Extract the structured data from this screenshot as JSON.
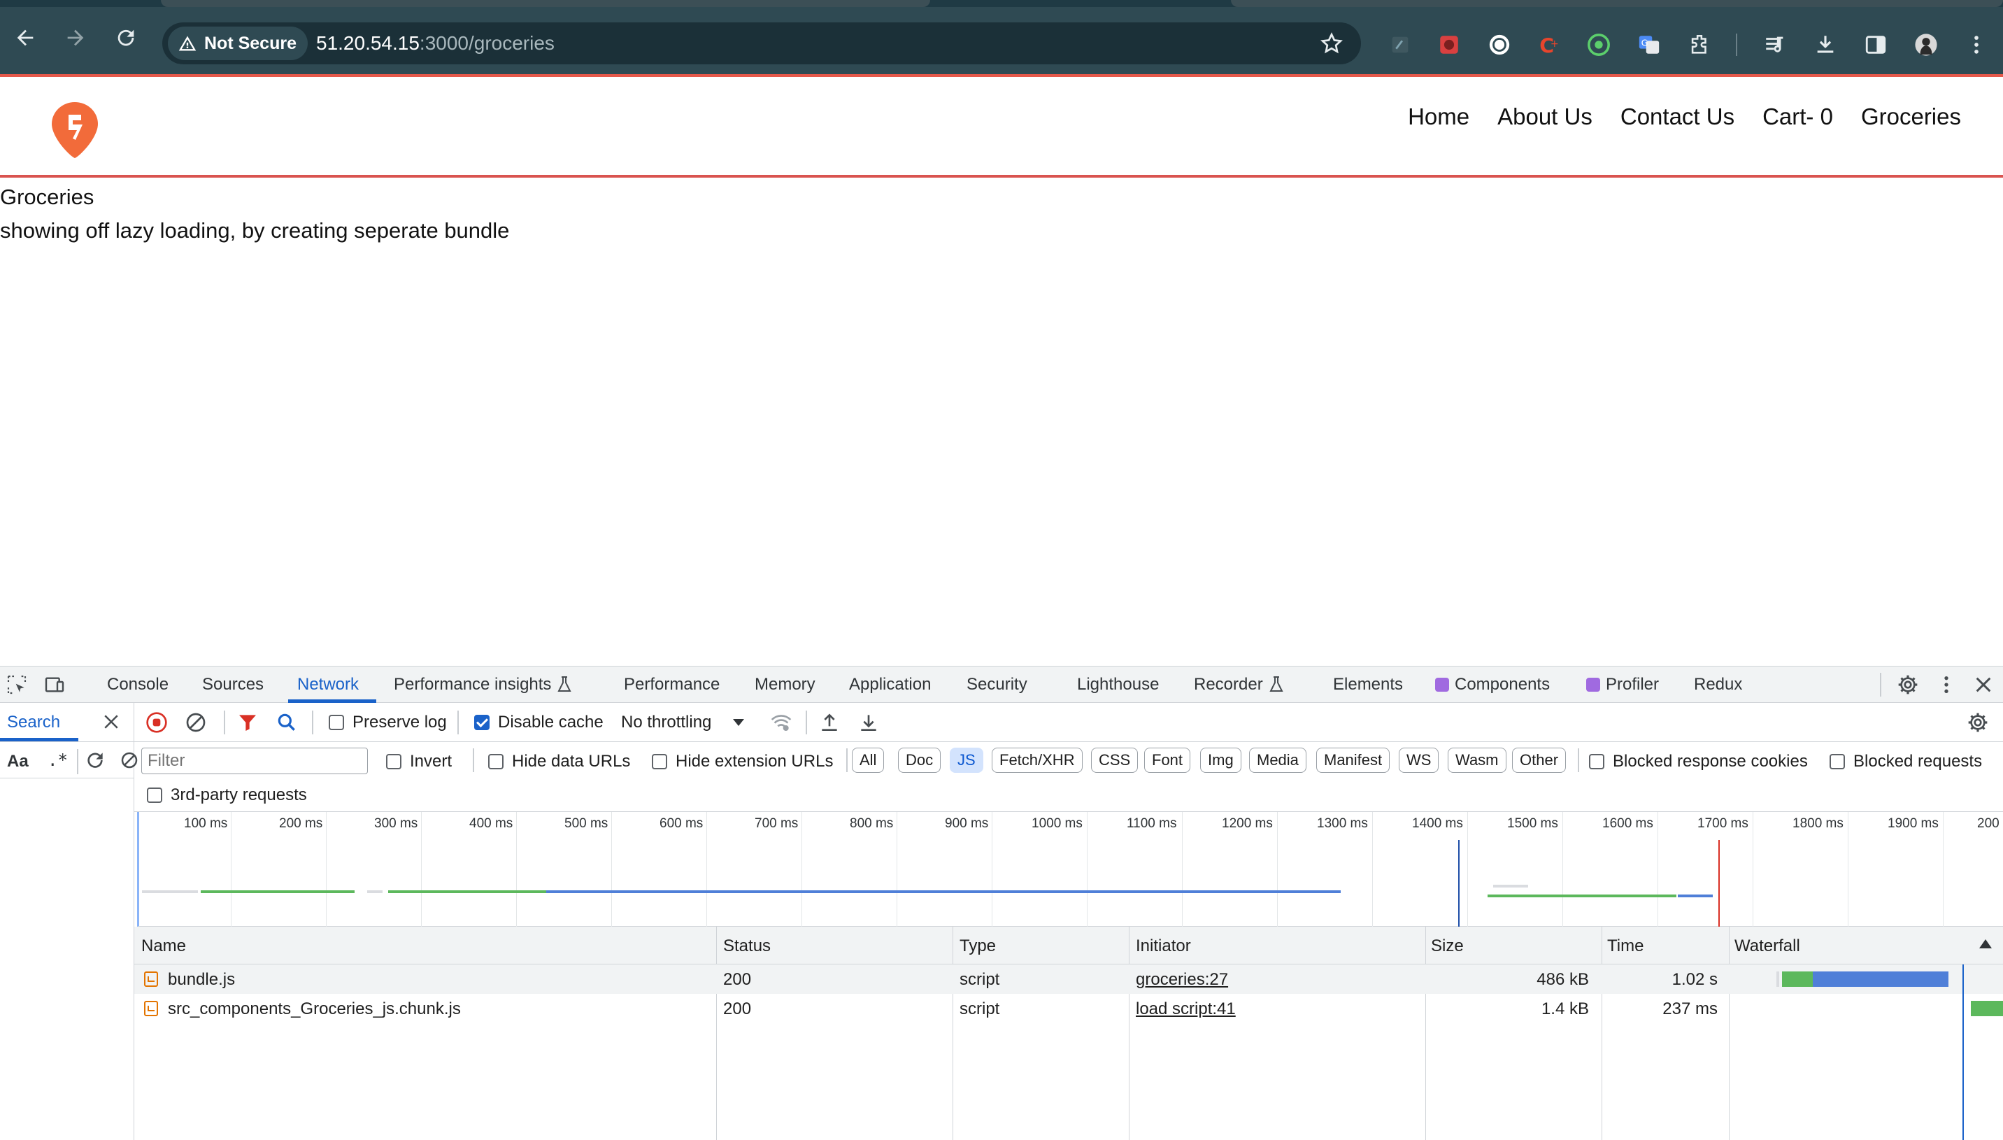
{
  "browser": {
    "security_label": "Not Secure",
    "url_host": "51.20.54.15",
    "url_rest": ":3000/groceries"
  },
  "page": {
    "nav": [
      "Home",
      "About Us",
      "Contact Us",
      "Cart- 0",
      "Groceries"
    ],
    "title": "Groceries",
    "subtitle": "showing off lazy loading, by creating seperate bundle",
    "accent_color": "#e5584a",
    "logo_color": "#f26b3a"
  },
  "devtools": {
    "tabs": [
      "Console",
      "Sources",
      "Network",
      "Performance insights",
      "Performance",
      "Memory",
      "Application",
      "Security",
      "Lighthouse",
      "Recorder",
      "Elements",
      "Components",
      "Profiler",
      "Redux"
    ],
    "active_tab": "Network",
    "search": {
      "tab_label": "Search",
      "case_label": "Aa",
      "regex_label": ".*"
    },
    "toolbar": {
      "preserve_log": "Preserve log",
      "disable_cache": "Disable cache",
      "throttling": "No throttling"
    },
    "filter": {
      "placeholder": "Filter",
      "invert": "Invert",
      "hide_data_urls": "Hide data URLs",
      "hide_extension_urls": "Hide extension URLs",
      "types": [
        "All",
        "Doc",
        "JS",
        "Fetch/XHR",
        "CSS",
        "Font",
        "Img",
        "Media",
        "Manifest",
        "WS",
        "Wasm",
        "Other"
      ],
      "active_type": "JS",
      "blocked_response_cookies": "Blocked response cookies",
      "blocked_requests": "Blocked requests",
      "third_party": "3rd-party requests"
    },
    "overview_ticks": [
      "100 ms",
      "200 ms",
      "300 ms",
      "400 ms",
      "500 ms",
      "600 ms",
      "700 ms",
      "800 ms",
      "900 ms",
      "1000 ms",
      "1100 ms",
      "1200 ms",
      "1300 ms",
      "1400 ms",
      "1500 ms",
      "1600 ms",
      "1700 ms",
      "1800 ms",
      "1900 ms",
      "200"
    ],
    "columns": [
      "Name",
      "Status",
      "Type",
      "Initiator",
      "Size",
      "Time",
      "Waterfall"
    ],
    "rows": [
      {
        "name": "bundle.js",
        "status": "200",
        "type": "script",
        "initiator": "groceries:27",
        "size": "486 kB",
        "time": "1.02 s"
      },
      {
        "name": "src_components_Groceries_js.chunk.js",
        "status": "200",
        "type": "script",
        "initiator": "load script:41",
        "size": "1.4 kB",
        "time": "237 ms"
      }
    ]
  }
}
